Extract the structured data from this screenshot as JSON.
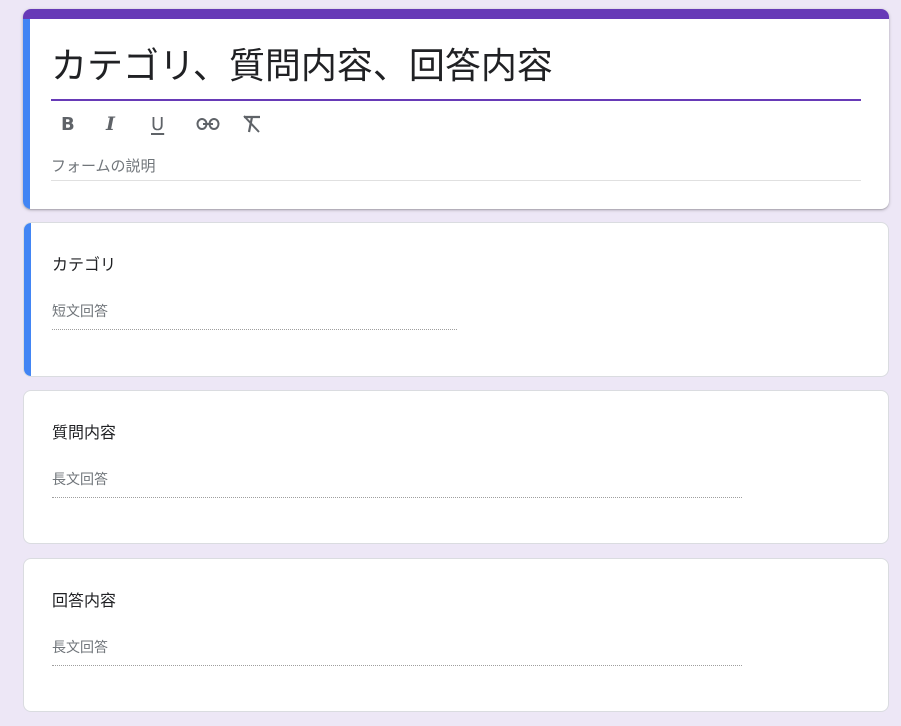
{
  "form": {
    "title": "カテゴリ、質問内容、回答内容",
    "description_placeholder": "フォームの説明",
    "toolbar": [
      {
        "name": "bold-icon",
        "glyph": "B"
      },
      {
        "name": "italic-icon",
        "glyph": "I"
      },
      {
        "name": "underline-icon",
        "glyph": "U"
      },
      {
        "name": "link-icon",
        "glyph": "link"
      },
      {
        "name": "clear-format-icon",
        "glyph": "clear"
      }
    ],
    "colors": {
      "accent": "#673ab7",
      "focus_bar": "#4285f4",
      "background": "#ede7f6"
    }
  },
  "questions": [
    {
      "label": "カテゴリ",
      "answer_type": "短文回答"
    },
    {
      "label": "質問内容",
      "answer_type": "長文回答"
    },
    {
      "label": "回答内容",
      "answer_type": "長文回答"
    }
  ]
}
